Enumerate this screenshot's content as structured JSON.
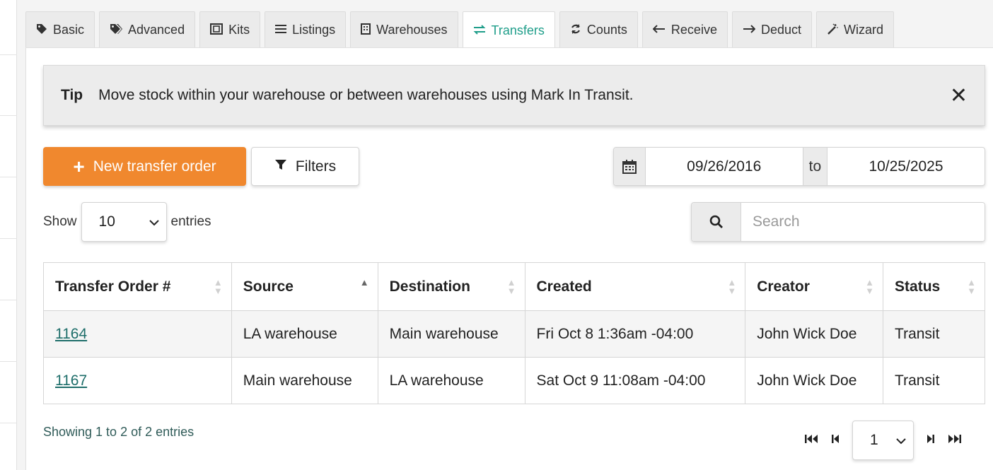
{
  "tabs": [
    {
      "label": "Basic",
      "icon": "tag-icon"
    },
    {
      "label": "Advanced",
      "icon": "tags-icon"
    },
    {
      "label": "Kits",
      "icon": "kit-icon"
    },
    {
      "label": "Listings",
      "icon": "list-icon"
    },
    {
      "label": "Warehouses",
      "icon": "building-icon"
    },
    {
      "label": "Transfers",
      "icon": "exchange-icon",
      "active": true
    },
    {
      "label": "Counts",
      "icon": "refresh-icon"
    },
    {
      "label": "Receive",
      "icon": "arrow-left-icon"
    },
    {
      "label": "Deduct",
      "icon": "arrow-right-icon"
    },
    {
      "label": "Wizard",
      "icon": "magic-wand-icon"
    }
  ],
  "tip": {
    "label": "Tip",
    "text": "Move stock within your warehouse or between warehouses using Mark In Transit."
  },
  "toolbar": {
    "new_label": "New transfer order",
    "filters_label": "Filters"
  },
  "daterange": {
    "from": "09/26/2016",
    "to_label": "to",
    "to": "10/25/2025"
  },
  "entries": {
    "show_label": "Show",
    "value": "10",
    "suffix": "entries"
  },
  "search": {
    "placeholder": "Search"
  },
  "table": {
    "headers": [
      "Transfer Order #",
      "Source",
      "Destination",
      "Created",
      "Creator",
      "Status"
    ],
    "rows": [
      {
        "order": "1164",
        "source": "LA warehouse",
        "destination": "Main warehouse",
        "created": "Fri Oct 8 1:36am -04:00",
        "creator": "John Wick Doe",
        "status": "Transit"
      },
      {
        "order": "1167",
        "source": "Main warehouse",
        "destination": "LA warehouse",
        "created": "Sat Oct 9 11:08am -04:00",
        "creator": "John Wick Doe",
        "status": "Transit"
      }
    ]
  },
  "footer": {
    "info": "Showing 1 to 2 of 2 entries",
    "page": "1"
  },
  "colors": {
    "accent": "#1f9e8a",
    "primary_button": "#f0882e",
    "link": "#1e6e6a"
  }
}
